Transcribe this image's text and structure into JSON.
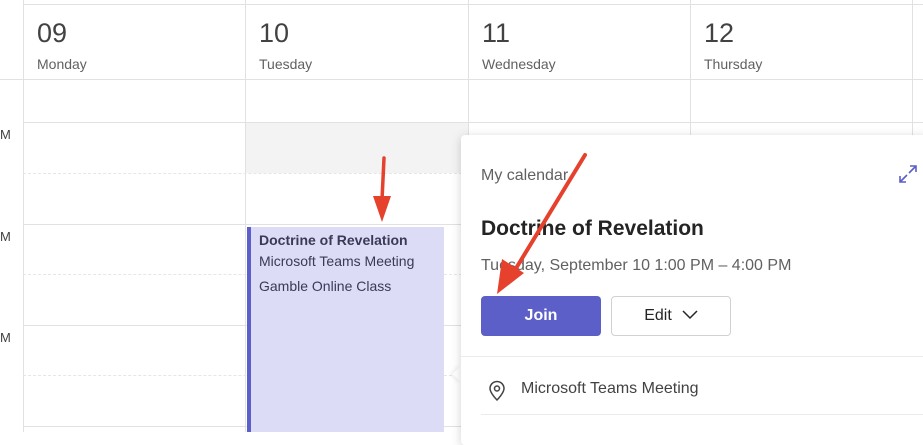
{
  "calendar": {
    "days": [
      {
        "number": "09",
        "name": "Monday"
      },
      {
        "number": "10",
        "name": "Tuesday"
      },
      {
        "number": "11",
        "name": "Wednesday"
      },
      {
        "number": "12",
        "name": "Thursday"
      }
    ],
    "time_labels": [
      "M",
      "M",
      "M"
    ]
  },
  "event": {
    "title": "Doctrine of Revelation",
    "line1": "Microsoft Teams Meeting",
    "line2": "Gamble Online Class",
    "accent_color": "#5b5fc7",
    "bg_color": "#dcdcf7"
  },
  "popup": {
    "calendar_label": "My calendar",
    "title": "Doctrine of Revelation",
    "time": "Tuesday, September 10 1:00 PM – 4:00 PM",
    "join_label": "Join",
    "edit_label": "Edit",
    "location": "Microsoft Teams Meeting",
    "expand_icon": "expand-icon",
    "location_icon": "location-pin-icon"
  },
  "annotations": {
    "arrow_color": "#e5412d"
  }
}
